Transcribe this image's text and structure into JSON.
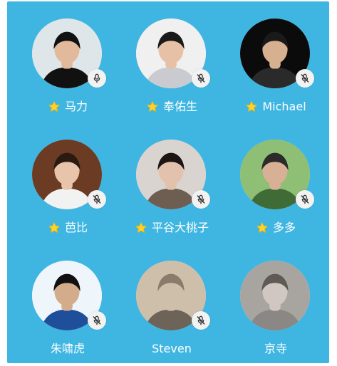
{
  "participants": [
    {
      "name": "马力",
      "host_star": true,
      "mic": "on",
      "avatar": {
        "bg": "#dfe6e9",
        "skin": "#e2b99a",
        "hair": "#111111",
        "shirt": "#111111"
      }
    },
    {
      "name": "奉佑生",
      "host_star": true,
      "mic": "muted",
      "avatar": {
        "bg": "#f0f0f0",
        "skin": "#e6c1a6",
        "hair": "#1a1a1a",
        "shirt": "#c9cbd0"
      }
    },
    {
      "name": "Michael",
      "host_star": true,
      "mic": "muted",
      "avatar": {
        "bg": "#0b0b0b",
        "skin": "#d7b08f",
        "hair": "#1a1a1a",
        "shirt": "#2a2a2a"
      }
    },
    {
      "name": "芭比",
      "host_star": true,
      "mic": "muted",
      "avatar": {
        "bg": "#6b3b23",
        "skin": "#e8c4ab",
        "hair": "#2a1a12",
        "shirt": "#f2f2f2"
      }
    },
    {
      "name": "平谷大桃子",
      "host_star": true,
      "mic": "muted",
      "avatar": {
        "bg": "#d9d4cf",
        "skin": "#e3c2ad",
        "hair": "#1d1514",
        "shirt": "#6e5e52"
      }
    },
    {
      "name": "多多",
      "host_star": true,
      "mic": "muted",
      "avatar": {
        "bg": "#8fbf74",
        "skin": "#d8b096",
        "hair": "#2b2b2b",
        "shirt": "#3f6b36"
      }
    },
    {
      "name": "朱啸虎",
      "host_star": false,
      "mic": "muted",
      "avatar": {
        "bg": "#eef6fb",
        "skin": "#d3ad8b",
        "hair": "#111111",
        "shirt": "#1f4f9b"
      }
    },
    {
      "name": "Steven",
      "host_star": false,
      "mic": "muted",
      "avatar": {
        "bg": "#cdbfaa",
        "skin": "#cdbfaa",
        "hair": "#8a7b6a",
        "shirt": "#6d6358"
      }
    },
    {
      "name": "京寺",
      "host_star": false,
      "mic": "none",
      "avatar": {
        "bg": "#a8a5a1",
        "skin": "#d0c7c1",
        "hair": "#5f5a56",
        "shirt": "#8b8784"
      }
    }
  ],
  "colors": {
    "panel_bg": "#3fb6e2",
    "name_text": "#ffffff",
    "star": "#ffd22e",
    "star_stroke": "#f2b700",
    "mic_bg": "#f2f2f2",
    "mic_icon": "#333333"
  }
}
